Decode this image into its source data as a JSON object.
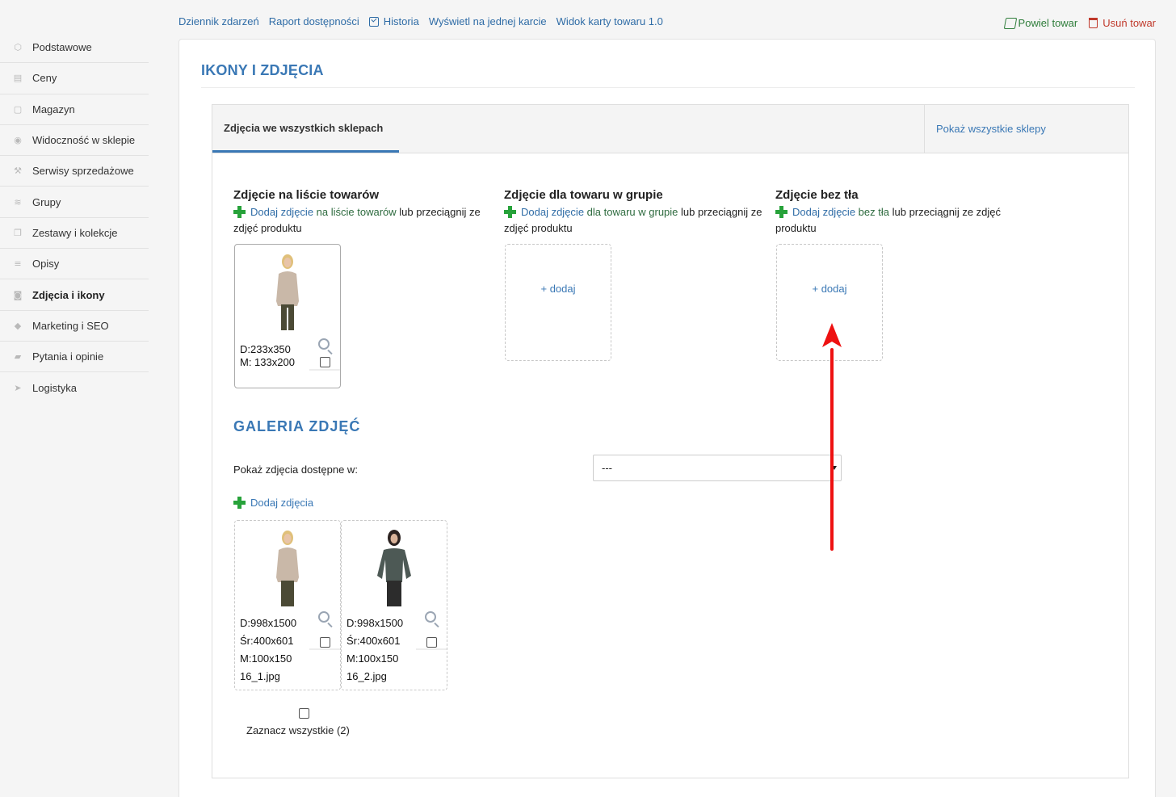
{
  "sidebar": {
    "items": [
      {
        "label": "Podstawowe",
        "icon": "cube-icon",
        "active": false
      },
      {
        "label": "Ceny",
        "icon": "money-icon",
        "active": false
      },
      {
        "label": "Magazyn",
        "icon": "box-icon",
        "active": false
      },
      {
        "label": "Widoczność w sklepie",
        "icon": "eye-icon",
        "active": false
      },
      {
        "label": "Serwisy sprzedażowe",
        "icon": "gavel-icon",
        "active": false
      },
      {
        "label": "Grupy",
        "icon": "layers-icon",
        "active": false
      },
      {
        "label": "Zestawy i kolekcje",
        "icon": "copy-icon",
        "active": false
      },
      {
        "label": "Opisy",
        "icon": "text-icon",
        "active": false
      },
      {
        "label": "Zdjęcia i ikony",
        "icon": "camera-icon",
        "active": true
      },
      {
        "label": "Marketing i SEO",
        "icon": "tag-icon",
        "active": false
      },
      {
        "label": "Pytania i opinie",
        "icon": "comments-icon",
        "active": false
      },
      {
        "label": "Logistyka",
        "icon": "paper-plane-icon",
        "active": false
      }
    ]
  },
  "topnav": {
    "event_log": "Dziennik zdarzeń",
    "availability_report": "Raport dostępności",
    "history": "Historia",
    "single_card": "Wyświetl na jednej karcie",
    "card_view": "Widok karty towaru 1.0"
  },
  "actions": {
    "duplicate": "Powiel towar",
    "delete": "Usuń towar"
  },
  "main": {
    "title": "IKONY I ZDJĘCIA",
    "tabs": {
      "all_shops": "Zdjęcia we wszystkich sklepach",
      "show_all_shops": "Pokaż wszystkie sklepy"
    },
    "columns": [
      {
        "title": "Zdjęcie na liście towarów",
        "add_link": "Dodaj zdjęcie",
        "target": "na liście towarów",
        "suffix": "lub przeciągnij ze zdjęć produktu",
        "image": {
          "dim_d": "D:233x350",
          "dim_m": "M: 133x200"
        }
      },
      {
        "title": "Zdjęcie dla towaru w grupie",
        "add_link": "Dodaj zdjęcie",
        "target": "dla towaru w grupie",
        "suffix": "lub przeciągnij ze zdjęć produktu",
        "empty_label": "+ dodaj"
      },
      {
        "title": "Zdjęcie bez tła",
        "add_link": "Dodaj zdjęcie",
        "target": "bez tła",
        "suffix": "lub przeciągnij ze zdjęć produktu",
        "empty_label": "+ dodaj"
      }
    ],
    "gallery": {
      "title": "GALERIA ZDJĘĆ",
      "show_label": "Pokaż zdjęcia dostępne w:",
      "select_value": "---",
      "add_photos": "Dodaj zdjęcia",
      "items": [
        {
          "d": "D:998x1500",
          "sr": "Śr:400x601",
          "m": "M:100x150",
          "file": "16_1.jpg",
          "sweater_color": "#c9b8a8"
        },
        {
          "d": "D:998x1500",
          "sr": "Śr:400x601",
          "m": "M:100x150",
          "file": "16_2.jpg",
          "sweater_color": "#4d5955"
        }
      ],
      "select_all": "Zaznacz wszystkie (2)"
    }
  },
  "colors": {
    "accent": "#3a78b5",
    "link": "#2f6ca6",
    "add_green": "#27a23a",
    "delete_red": "#c0392b",
    "arrow_red": "#ee1111"
  }
}
